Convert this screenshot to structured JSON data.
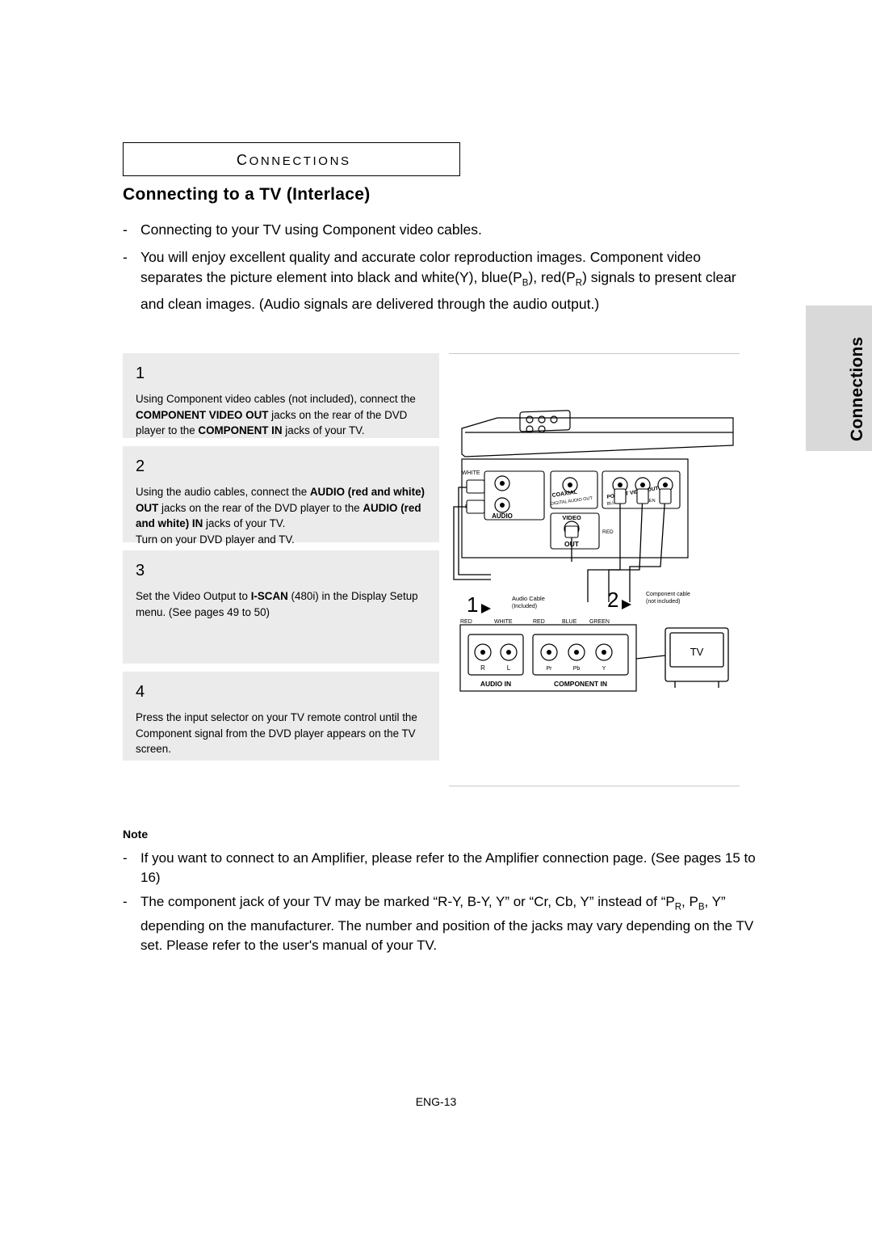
{
  "side_tab": {
    "label": "Connections"
  },
  "header": {
    "section_first": "C",
    "section_rest": "ONNECTIONS",
    "title": "Connecting to a TV (Interlace)"
  },
  "intro": [
    {
      "dash": "-",
      "text": "Connecting to your TV using Component video cables."
    },
    {
      "dash": "-",
      "text": "You will enjoy excellent quality and accurate color reproduction images. Component video separates the picture element into black and white(Y), blue(PB), red(PR) signals to present clear and clean images. (Audio signals are delivered through the audio output.)"
    }
  ],
  "steps": [
    {
      "num": "1",
      "text": "Using Component video cables (not included), connect the COMPONENT VIDEO OUT jacks on the rear of the DVD player to the COMPONENT IN jacks of your TV."
    },
    {
      "num": "2",
      "text": "Using the audio cables, connect the AUDIO (red and white) OUT jacks on the rear of the DVD player to the AUDIO (red and white) IN jacks of your TV. Turn on your DVD player and TV."
    },
    {
      "num": "3",
      "text": "Set the Video Output to I-SCAN (480i) in the Display Setup menu. (See pages 49 to 50)"
    },
    {
      "num": "4",
      "text": "Press the input selector on your TV remote control until the Component signal from the DVD player appears on the TV screen."
    }
  ],
  "diagram": {
    "labels": {
      "white": "WHITE",
      "red": "RED",
      "audio": "AUDIO",
      "out": "OUT",
      "video": "VIDEO",
      "coaxial": "COAXIAL",
      "digital_audio_out": "DIGITAL AUDIO OUT",
      "component": "COMPONENT VIDEO OUT",
      "blue": "BLUE",
      "green": "GREEN",
      "red2": "RED",
      "marker1": "1",
      "marker2": "2",
      "audio_cable": "Audio Cable",
      "audio_cable_incl": "(Included)",
      "comp_cable": "Component cable",
      "comp_cable_not": "(not included)",
      "in_red": "RED",
      "in_white": "WHITE",
      "in_red2": "RED",
      "in_blue": "BLUE",
      "in_green": "GREEN",
      "r": "R",
      "l": "L",
      "pr": "Pr",
      "pb": "Pb",
      "y": "Y",
      "audio_in": "AUDIO IN",
      "component_in": "COMPONENT IN",
      "tv": "TV"
    }
  },
  "note": {
    "heading": "Note",
    "items": [
      {
        "dash": "-",
        "text": "If you want to connect to an Amplifier, please refer to the Amplifier connection page. (See pages 15 to 16)"
      },
      {
        "dash": "-",
        "text": "The component jack of your TV may be marked “R-Y, B-Y, Y” or “Cr, Cb, Y” instead of “PR, PB, Y” depending on the manufacturer. The number and position of the jacks may vary depending on the TV set. Please refer to the user's manual of your TV."
      }
    ]
  },
  "footer": {
    "page": "ENG-13"
  }
}
